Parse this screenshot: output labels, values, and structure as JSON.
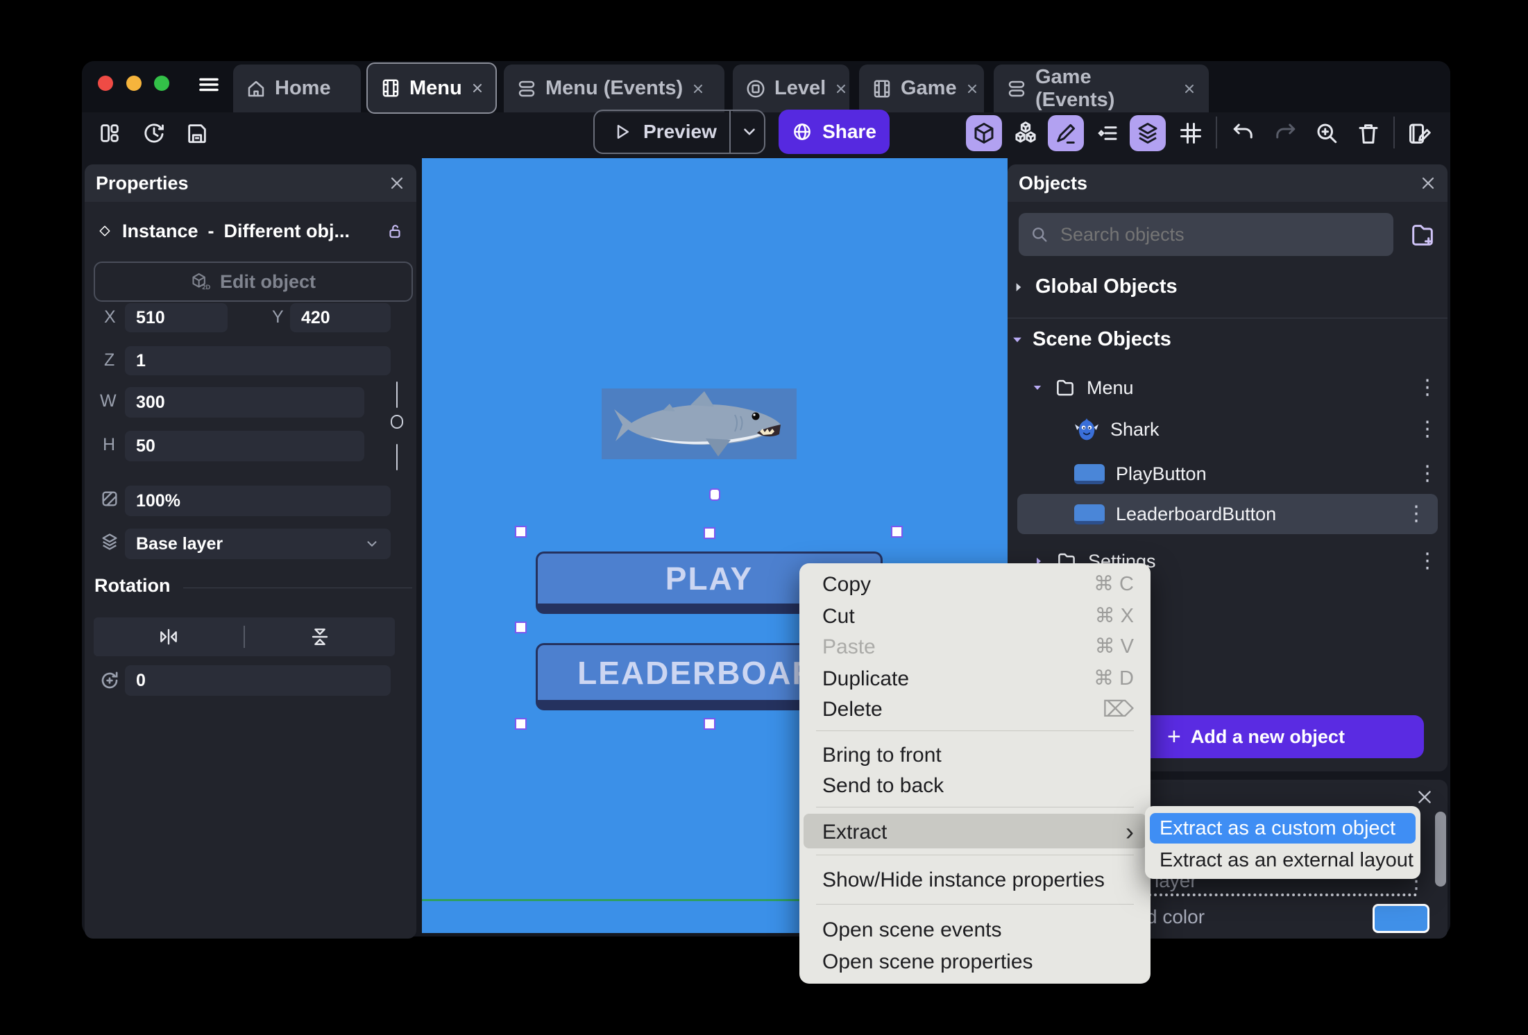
{
  "window": {
    "tabs": [
      {
        "label": "Home",
        "closable": false,
        "active": false
      },
      {
        "label": "Menu",
        "closable": true,
        "active": true
      },
      {
        "label": "Menu (Events)",
        "closable": true,
        "active": false
      },
      {
        "label": "Level",
        "closable": true,
        "active": false
      },
      {
        "label": "Game",
        "closable": true,
        "active": false
      },
      {
        "label": "Game (Events)",
        "closable": true,
        "active": false
      }
    ],
    "toolbar": {
      "preview_label": "Preview",
      "share_label": "Share"
    }
  },
  "properties_panel": {
    "title": "Properties",
    "instance_label": "Instance",
    "dash": "-",
    "instance_value": "Different obj...",
    "edit_object_label": "Edit object",
    "x_label": "X",
    "x_value": "510",
    "y_label": "Y",
    "y_value": "420",
    "z_label": "Z",
    "z_value": "1",
    "w_label": "W",
    "w_value": "300",
    "h_label": "H",
    "h_value": "50",
    "opacity_value": "100%",
    "layer_value": "Base layer",
    "rotation_title": "Rotation",
    "rotation_value": "0"
  },
  "canvas": {
    "play_label": "PLAY",
    "leaderboard_label": "LEADERBOARD"
  },
  "objects_panel": {
    "title": "Objects",
    "search_placeholder": "Search objects",
    "global_header": "Global Objects",
    "scene_header": "Scene Objects",
    "folder_menu": "Menu",
    "shark": "Shark",
    "play_button": "PlayButton",
    "leaderboard_button": "LeaderboardButton",
    "settings": "Settings",
    "add_plus": "+",
    "add_button": "Add a new object"
  },
  "layers_panel": {
    "layer_fragment": "layer",
    "color_fragment": "d color"
  },
  "context_menu": {
    "items": [
      {
        "label": "Copy",
        "shortcut": "⌘ C"
      },
      {
        "label": "Cut",
        "shortcut": "⌘ X"
      },
      {
        "label": "Paste",
        "shortcut": "⌘ V",
        "disabled": true
      },
      {
        "label": "Duplicate",
        "shortcut": "⌘ D"
      },
      {
        "label": "Delete",
        "shortcut": "⌦"
      },
      {
        "label": "Bring to front"
      },
      {
        "label": "Send to back"
      },
      {
        "label": "Extract",
        "arrow": "›"
      },
      {
        "label": "Show/Hide instance properties"
      },
      {
        "label": "Open scene events"
      },
      {
        "label": "Open scene properties"
      }
    ]
  },
  "extract_submenu": {
    "items": [
      {
        "label": "Extract as a custom object",
        "highlighted": true
      },
      {
        "label": "Extract as an external layout",
        "highlighted": false
      }
    ]
  },
  "colors": {
    "accent_purple": "#5629e0",
    "toolbar_highlight": "#b2a1f1",
    "canvas_blue": "#3b90e8",
    "selection_blue": "#3f8ef4",
    "ground_green": "#2f9f5d",
    "swatch_blue": "#4090e8"
  }
}
